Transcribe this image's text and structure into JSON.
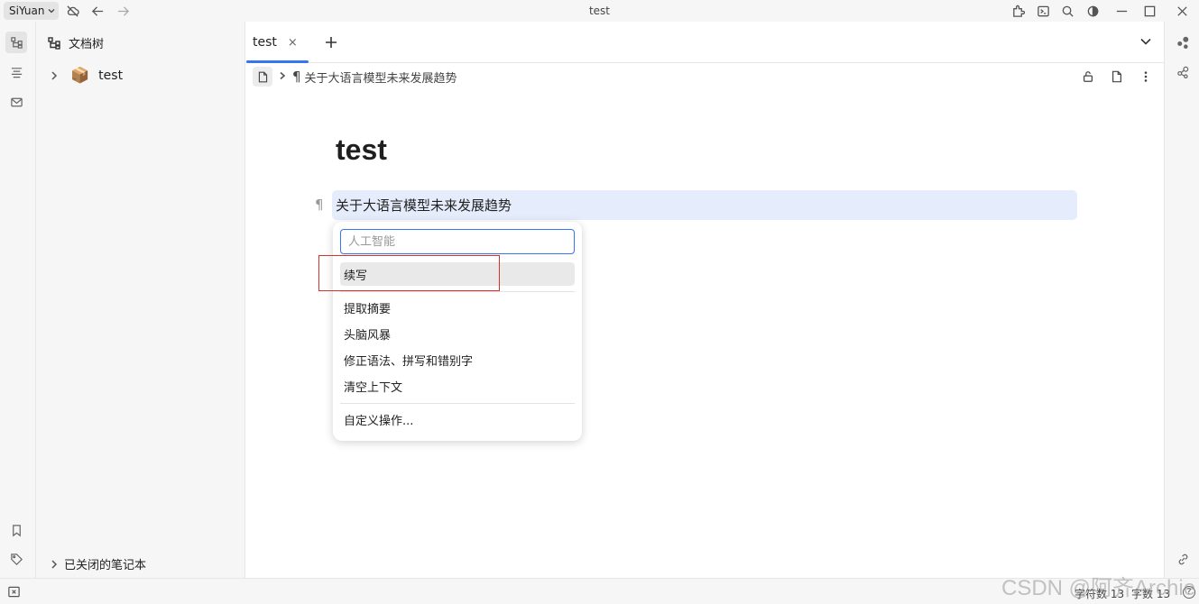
{
  "app": {
    "name": "SiYuan",
    "window_title": "test"
  },
  "file_tree": {
    "title": "文档树",
    "notebooks": [
      {
        "label": "test",
        "icon": "📦"
      }
    ],
    "closed_notebooks": "已关闭的笔记本"
  },
  "tabs": [
    {
      "label": "test",
      "close": "×"
    }
  ],
  "breadcrumb": {
    "paragraph_mark": "¶",
    "label": "关于大语言模型未来发展趋势"
  },
  "document": {
    "title": "test",
    "paragraph_mark": "¶",
    "block_text": "关于大语言模型未来发展趋势"
  },
  "ai_menu": {
    "input_placeholder": "人工智能",
    "items_group1": [
      "续写"
    ],
    "items_group2": [
      "提取摘要",
      "头脑风暴",
      "修正语法、拼写和错别字",
      "清空上下文"
    ],
    "items_group3": [
      "自定义操作..."
    ]
  },
  "statusbar": {
    "char_count": "字符数 13",
    "word_count": "字数 13",
    "help": "?"
  },
  "watermark": "CSDN @阿齐Archie",
  "colors": {
    "accent": "#3575f0",
    "block_highlight": "#e5ecfb",
    "annotation_box": "#d8322e"
  }
}
